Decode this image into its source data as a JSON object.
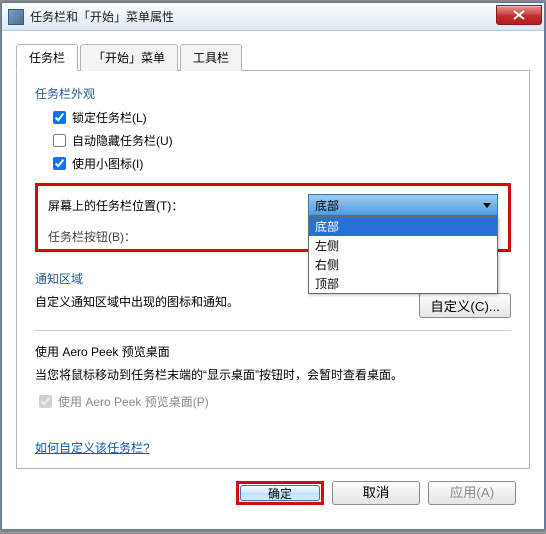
{
  "window": {
    "title": "任务栏和「开始」菜单属性",
    "close_label": "X"
  },
  "tabs": {
    "taskbar": "任务栏",
    "start": "「开始」菜单",
    "toolbars": "工具栏"
  },
  "appearance": {
    "title": "任务栏外观",
    "lock": "锁定任务栏(L)",
    "autohide": "自动隐藏任务栏(U)",
    "smallicons": "使用小图标(I)"
  },
  "location": {
    "label": "屏幕上的任务栏位置(T)：",
    "value": "底部",
    "buttons_label": "任务栏按钮(B)：",
    "options": {
      "bottom": "底部",
      "left": "左侧",
      "right": "右侧",
      "top": "顶部"
    }
  },
  "notify": {
    "title": "通知区域",
    "desc": "自定义通知区域中出现的图标和通知。",
    "button": "自定义(C)..."
  },
  "aero": {
    "title": "使用 Aero Peek 预览桌面",
    "desc": "当您将鼠标移动到任务栏末端的“显示桌面”按钮时，会暂时查看桌面。",
    "checkbox": "使用 Aero Peek 预览桌面(P)"
  },
  "link": "如何自定义该任务栏?",
  "buttons": {
    "ok": "确定",
    "cancel": "取消",
    "apply": "应用(A)"
  }
}
